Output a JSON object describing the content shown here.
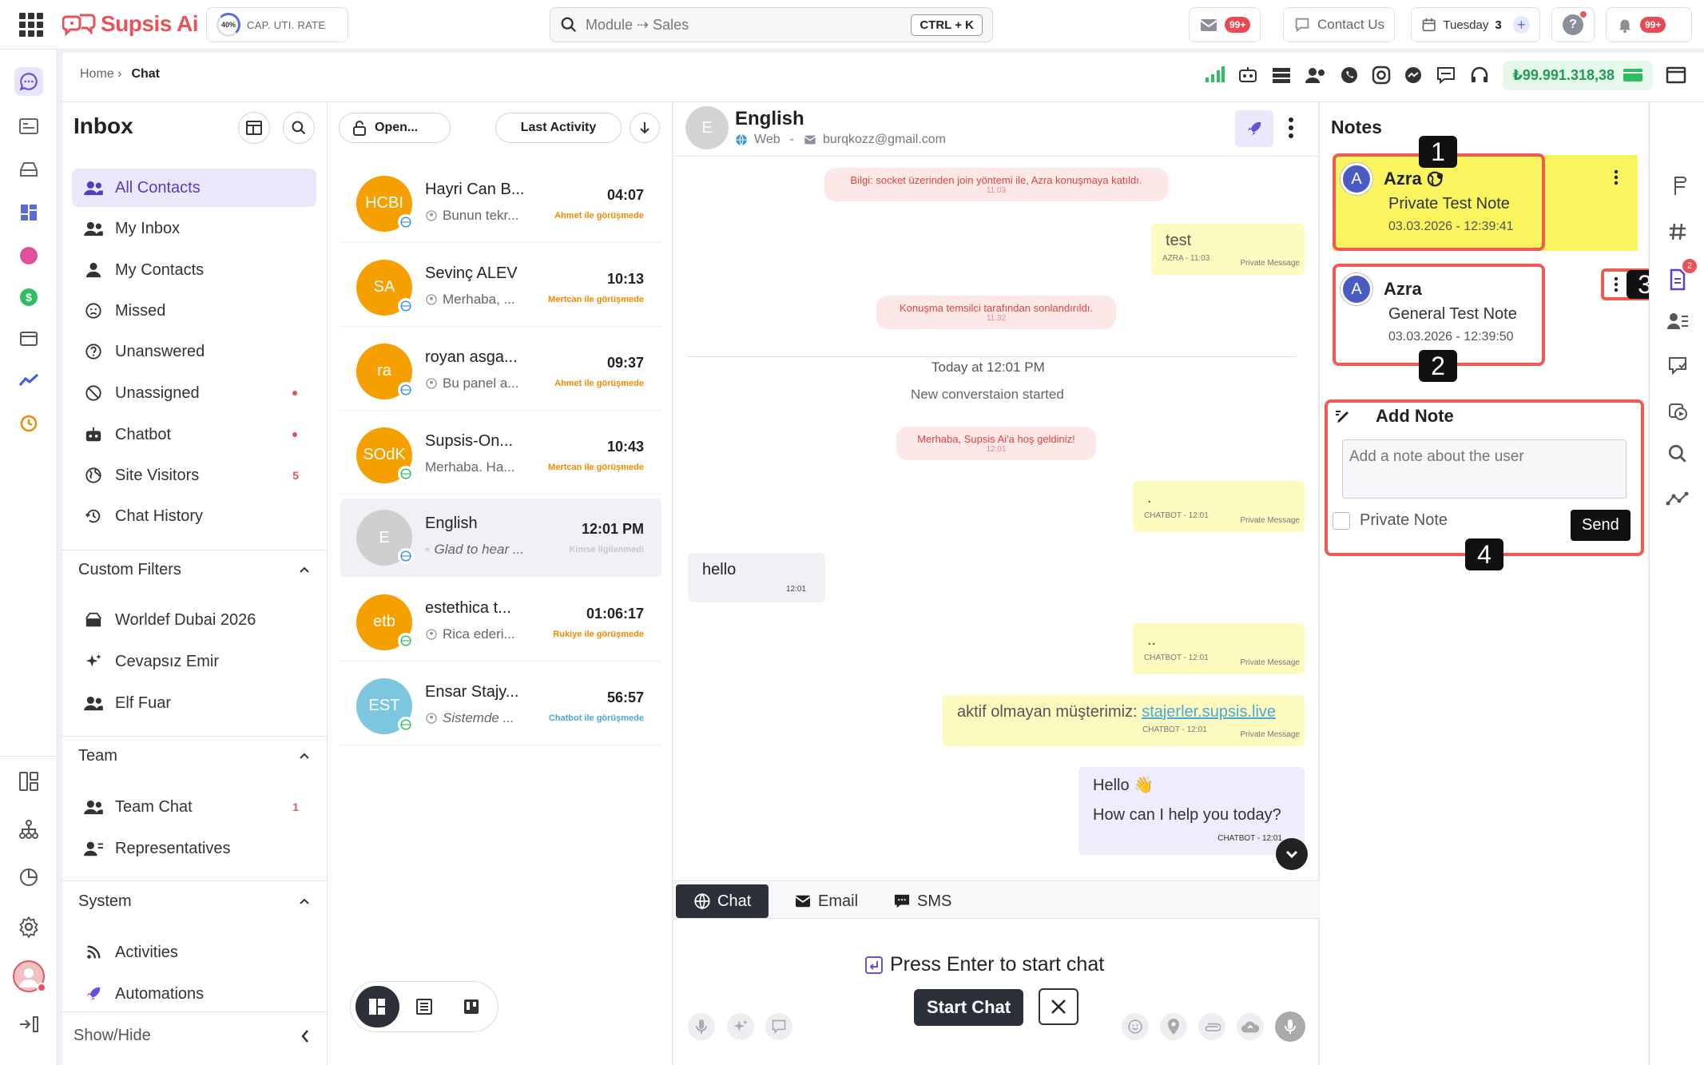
{
  "app": {
    "name": "Supsis Ai"
  },
  "topbar": {
    "cap_value": "40%",
    "cap_label": "CAP. UTI. RATE",
    "search_placeholder": "Module ⇢ Sales",
    "search_shortcut": "CTRL + K",
    "mail_badge": "99+",
    "contact_us": "Contact Us",
    "date_label": "Tuesday",
    "date_day": "3",
    "notif_badge": "99+"
  },
  "breadcrumb": {
    "home": "Home ›",
    "current": "Chat"
  },
  "balance": "₺99.991.318,38",
  "inbox": {
    "title": "Inbox",
    "items": [
      {
        "label": "All Contacts",
        "count": ""
      },
      {
        "label": "My Inbox",
        "count": ""
      },
      {
        "label": "My Contacts",
        "count": ""
      },
      {
        "label": "Missed",
        "count": ""
      },
      {
        "label": "Unanswered",
        "count": ""
      },
      {
        "label": "Unassigned",
        "count": ""
      },
      {
        "label": "Chatbot",
        "count": ""
      },
      {
        "label": "Site Visitors",
        "count": "5"
      },
      {
        "label": "Chat History",
        "count": ""
      }
    ],
    "custom_filters": {
      "title": "Custom Filters",
      "items": [
        {
          "label": "Worldef Dubai 2026"
        },
        {
          "label": "Cevapsız Emir"
        },
        {
          "label": "Elf Fuar"
        }
      ]
    },
    "team": {
      "title": "Team",
      "items": [
        {
          "label": "Team Chat",
          "count": "1"
        },
        {
          "label": "Representatives",
          "count": ""
        }
      ]
    },
    "system": {
      "title": "System",
      "items": [
        {
          "label": "Activities"
        },
        {
          "label": "Automations"
        }
      ]
    },
    "show_hide": "Show/Hide"
  },
  "conversations": {
    "filter_label": "Open...",
    "sort_label": "Last Activity",
    "items": [
      {
        "initials": "HCBI",
        "name": "Hayri Can B...",
        "time": "04:07",
        "preview": "Bunun tekr...",
        "agent": "Ahmet ile görüşmede",
        "color": "#f5a000",
        "agent_color": "#f08a00"
      },
      {
        "initials": "SA",
        "name": "Sevinç ALEV",
        "time": "10:13",
        "preview": "Merhaba, ...",
        "agent": "Mertcan ile görüşmede",
        "color": "#f5a000",
        "agent_color": "#f08a00"
      },
      {
        "initials": "ra",
        "name": "royan asga...",
        "time": "09:37",
        "preview": "Bu panel a...",
        "agent": "Ahmet ile görüşmede",
        "color": "#f5a000",
        "agent_color": "#f08a00"
      },
      {
        "initials": "SOdK",
        "name": "Supsis-On...",
        "time": "10:43",
        "preview": "Merhaba. Ha...",
        "agent": "Mertcan ile görüşmede",
        "color": "#f5a000",
        "agent_color": "#f08a00"
      },
      {
        "initials": "E",
        "name": "English",
        "time": "12:01 PM",
        "preview": "Glad to hear ...",
        "agent": "Kimse ilgilenmedi",
        "color": "#cfcfcf",
        "agent_color": "#c8c8c8"
      },
      {
        "initials": "etb",
        "name": "estethica t...",
        "time": "01:06:17",
        "preview": "Rica ederi...",
        "agent": "Rukiye ile görüşmede",
        "color": "#f5a000",
        "agent_color": "#f08a00"
      },
      {
        "initials": "EST",
        "name": "Ensar Stajy...",
        "time": "56:57",
        "preview": "Sistemde ...",
        "agent": "Chatbot ile görüşmede",
        "color": "#7cc6e0",
        "agent_color": "#4aa8d6"
      }
    ]
  },
  "chat": {
    "contact_name": "English",
    "contact_initial": "E",
    "channel": "Web",
    "email": "burqkozz@gmail.com",
    "sys1": {
      "text": "Bilgi: socket üzerinden join yöntemi ile, Azra konuşmaya katıldı.",
      "time": "11:03"
    },
    "msg_test": {
      "text": "test",
      "meta": "AZRA - 11:03",
      "private": "Private Message"
    },
    "sys2": {
      "text": "Konuşma temsilci tarafından sonlandırıldı.",
      "time": "11:32"
    },
    "divider_label": "Today at 12:01 PM",
    "new_conv": "New converstaion started",
    "sys3": {
      "text": "Merhaba, Supsis Ai'a hoş geldiniz!",
      "time": "12:01"
    },
    "msg_dot1": {
      "text": ".",
      "meta": "CHATBOT - 12:01",
      "private": "Private Message"
    },
    "msg_hello": {
      "text": "hello",
      "time": "12:01"
    },
    "msg_dot2": {
      "text": "..",
      "meta": "CHATBOT - 12:01",
      "private": "Private Message"
    },
    "msg_inactive": {
      "text": "aktif olmayan müşterimiz:",
      "link": "stajerler.supsis.live",
      "meta": "CHATBOT - 12:01",
      "private": "Private Message"
    },
    "msg_bot": {
      "line1": "Hello 👋",
      "line2": "How can I help you today?",
      "meta": "CHATBOT - 12:01"
    },
    "tabs": [
      {
        "label": "Chat"
      },
      {
        "label": "Email"
      },
      {
        "label": "SMS"
      }
    ],
    "press_enter": "Press Enter to start chat",
    "start_chat": "Start Chat"
  },
  "notes": {
    "title": "Notes",
    "items": [
      {
        "author": "Azra",
        "text": "Private Test Note",
        "date": "03.03.2026 - 12:39:41",
        "initial": "A"
      },
      {
        "author": "Azra",
        "text": "General Test Note",
        "date": "03.03.2026 - 12:39:50",
        "initial": "A"
      }
    ],
    "add_title": "Add Note",
    "placeholder": "Add a note about the user",
    "private_label": "Private Note",
    "send": "Send",
    "tags": [
      "1",
      "2",
      "3",
      "4"
    ]
  },
  "right_rail": {
    "notes_badge": "2"
  }
}
